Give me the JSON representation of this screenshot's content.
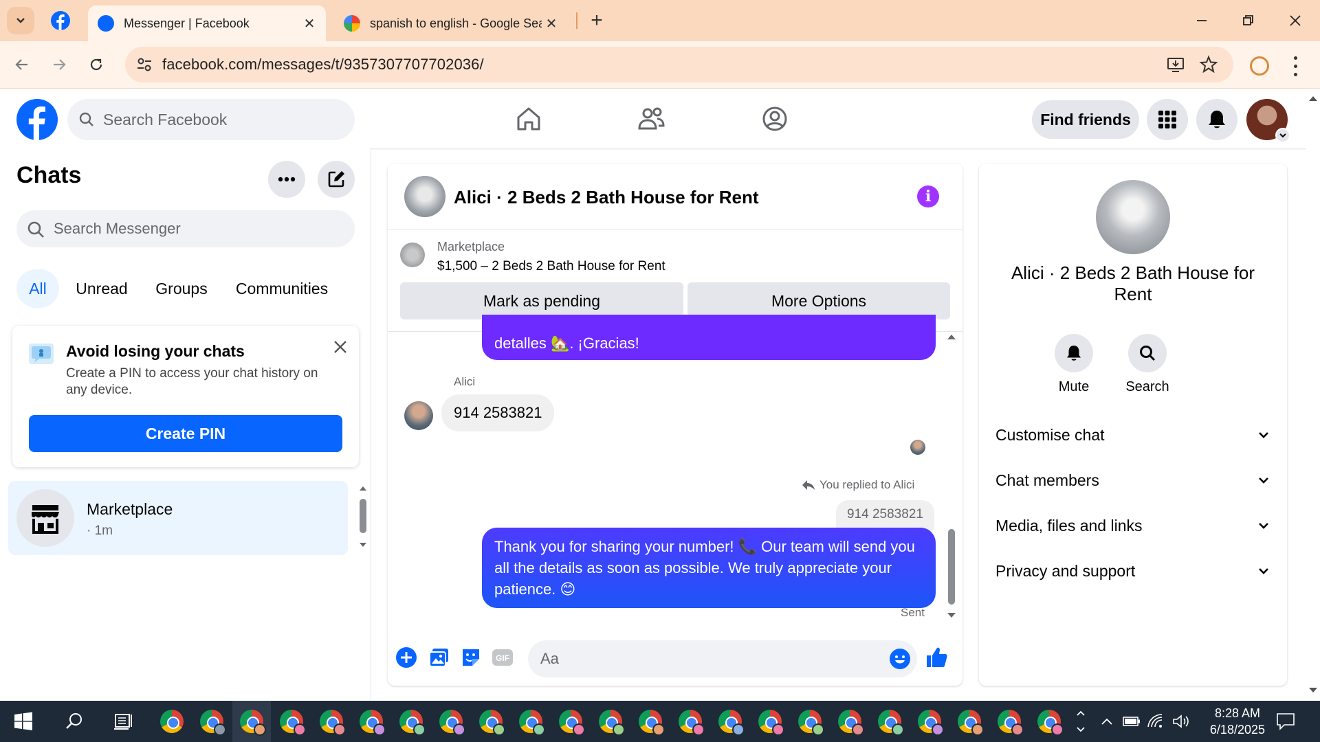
{
  "browser": {
    "tabs": [
      {
        "title": "Messenger | Facebook",
        "active": true
      },
      {
        "title": "spanish to english - Google Sea",
        "active": false
      }
    ],
    "url": "facebook.com/messages/t/9357307707702036/"
  },
  "header": {
    "search_placeholder": "Search Facebook",
    "find_friends": "Find friends"
  },
  "sidebar": {
    "title": "Chats",
    "search_placeholder": "Search Messenger",
    "filters": [
      "All",
      "Unread",
      "Groups",
      "Communities"
    ],
    "pin_card": {
      "title": "Avoid losing your chats",
      "description": "Create a PIN to access your chat history on any device.",
      "button": "Create PIN"
    },
    "chat_item": {
      "name": "Marketplace",
      "time": "· 1m"
    }
  },
  "conversation": {
    "title": "Alici · 2 Beds 2 Bath House for Rent",
    "marketplace_label": "Marketplace",
    "listing": "$1,500 – 2 Beds 2 Bath House for Rent",
    "mark_pending": "Mark as pending",
    "more_options": "More Options",
    "messages": {
      "partial_out": "detalles 🏡. ¡Gracias!",
      "sender_name": "Alici",
      "incoming": "914 2583821",
      "reply_note": "You replied to Alici",
      "quoted": "914 2583821",
      "outgoing": "Thank you for sharing your number! 📞 Our team will send you all the details as soon as possible. We truly appreciate your patience. 😊",
      "status": "Sent"
    },
    "composer_placeholder": "Aa"
  },
  "details": {
    "name": "Alici · 2 Beds 2 Bath House for Rent",
    "actions": [
      {
        "label": "Mute"
      },
      {
        "label": "Search"
      }
    ],
    "sections": [
      "Customise chat",
      "Chat members",
      "Media, files and links",
      "Privacy and support"
    ]
  },
  "taskbar": {
    "time": "8:28 AM",
    "date": "6/18/2025"
  },
  "colors": {
    "fb_blue": "#0866ff",
    "message_purple": "#6d2bff",
    "info_purple": "#a033ff"
  }
}
